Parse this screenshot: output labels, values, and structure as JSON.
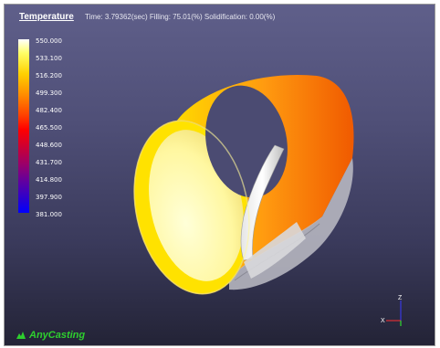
{
  "header": {
    "title": "Temperature",
    "status": "Time: 3.79362(sec)  Filling: 75.01(%)  Solidification: 0.00(%)"
  },
  "legend": {
    "ticks": [
      "550.000",
      "533.100",
      "516.200",
      "499.300",
      "482.400",
      "465.500",
      "448.600",
      "431.700",
      "414.800",
      "397.900",
      "381.000"
    ]
  },
  "brand": {
    "name": "AnyCasting"
  },
  "axes": {
    "z": "Z",
    "x": "X"
  },
  "colors": {
    "hot": "#ffff66",
    "mid": "#ff8c00",
    "cold": "#0000ff",
    "brand_green": "#2ecf2e"
  }
}
